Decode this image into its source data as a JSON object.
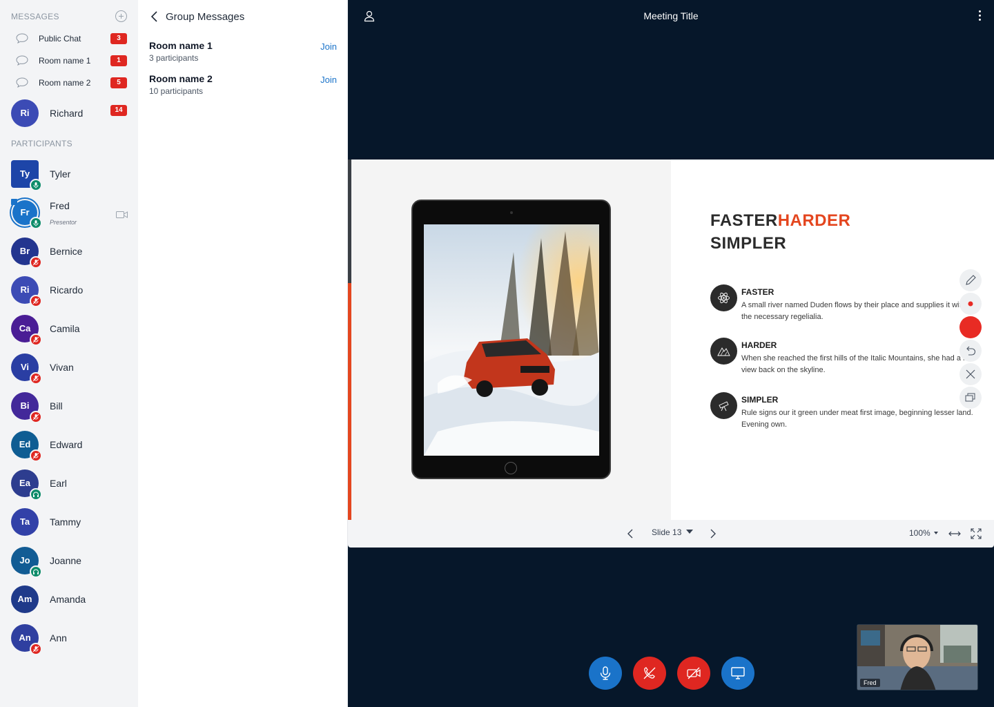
{
  "sidebar": {
    "messages_title": "MESSAGES",
    "messages": [
      {
        "label": "Public Chat",
        "badge": "3"
      },
      {
        "label": "Room name 1",
        "badge": "1"
      },
      {
        "label": "Room name 2",
        "badge": "5"
      }
    ],
    "direct": {
      "initials": "Ri",
      "name": "Richard",
      "badge": "14"
    },
    "participants_title": "PARTICIPANTS",
    "participants": [
      {
        "initials": "Ty",
        "name": "Tyler",
        "status": "mic-on"
      },
      {
        "initials": "Fr",
        "name": "Fred",
        "role": "Presentor",
        "status": "mic-on"
      },
      {
        "initials": "Br",
        "name": "Bernice",
        "status": "mic-muted"
      },
      {
        "initials": "Ri",
        "name": "Ricardo",
        "status": "mic-muted"
      },
      {
        "initials": "Ca",
        "name": "Camila",
        "status": "mic-muted"
      },
      {
        "initials": "Vi",
        "name": "Vivan",
        "status": "mic-muted"
      },
      {
        "initials": "Bi",
        "name": "Bill",
        "status": "mic-muted"
      },
      {
        "initials": "Ed",
        "name": "Edward",
        "status": "mic-muted"
      },
      {
        "initials": "Ea",
        "name": "Earl",
        "status": "listen-only"
      },
      {
        "initials": "Ta",
        "name": "Tammy",
        "status": "none"
      },
      {
        "initials": "Jo",
        "name": "Joanne",
        "status": "listen-only"
      },
      {
        "initials": "Am",
        "name": "Amanda",
        "status": "none"
      },
      {
        "initials": "An",
        "name": "Ann",
        "status": "mic-muted"
      }
    ]
  },
  "group_panel": {
    "title": "Group Messages",
    "rooms": [
      {
        "name": "Room name 1",
        "participants": "3 participants",
        "action": "Join"
      },
      {
        "name": "Room name 2",
        "participants": "10 participants",
        "action": "Join"
      }
    ]
  },
  "meeting": {
    "title": "Meeting Title",
    "slide": {
      "heading_part1": "FASTER",
      "heading_part2": "HARDER",
      "heading_line2": "SIMPLER",
      "features": [
        {
          "title": "FASTER",
          "desc": "A small river named Duden flows by their place and supplies it with the necessary regelialia.",
          "icon": "atom-icon"
        },
        {
          "title": "HARDER",
          "desc": "When she reached the first hills of the Italic Mountains, she had a last view back on the skyline.",
          "icon": "mountain-icon"
        },
        {
          "title": "SIMPLER",
          "desc": "Rule signs our it green under meat first image, beginning lesser land. Evening own.",
          "icon": "telescope-icon"
        }
      ]
    },
    "slide_controls": {
      "current": "Slide 13",
      "zoom": "100%"
    },
    "self_view_label": "Fred"
  },
  "colors": {
    "accent_orange": "#e4461f",
    "brand_blue": "#1a73c9",
    "alert_red": "#df2721",
    "main_bg": "#06172a",
    "avatar_palette": [
      "#1d45a8",
      "#1a73c9",
      "#23358f",
      "#3c4bb5",
      "#4a1d95",
      "#2a3ea3",
      "#43289a",
      "#0f5d93",
      "#2d3d8f",
      "#3241a8",
      "#125c94",
      "#1f3a8a",
      "#2f3fa0"
    ]
  }
}
